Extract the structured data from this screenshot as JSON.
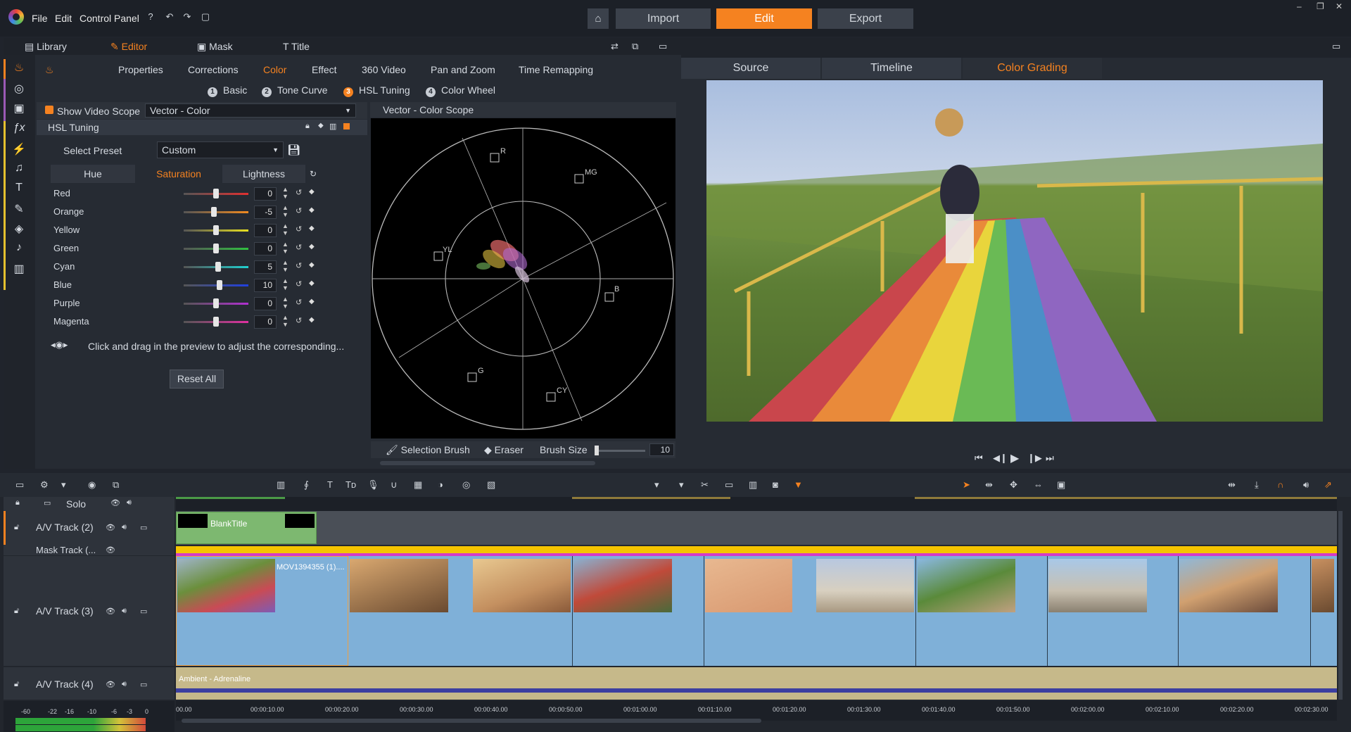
{
  "menu": {
    "file": "File",
    "edit": "Edit",
    "control_panel": "Control Panel"
  },
  "top_tabs": {
    "import": "Import",
    "edit": "Edit",
    "export": "Export"
  },
  "panel_tabs": [
    {
      "label": "Library"
    },
    {
      "label": "Editor"
    },
    {
      "label": "Mask"
    },
    {
      "label": "Title"
    }
  ],
  "subtabs": [
    "Properties",
    "Corrections",
    "Color",
    "Effect",
    "360 Video",
    "Pan and Zoom",
    "Time Remapping"
  ],
  "steps": [
    {
      "n": "1",
      "label": "Basic"
    },
    {
      "n": "2",
      "label": "Tone Curve"
    },
    {
      "n": "3",
      "label": "HSL Tuning"
    },
    {
      "n": "4",
      "label": "Color Wheel"
    }
  ],
  "scope": {
    "show_label": "Show Video Scope",
    "select_value": "Vector - Color",
    "panel_title": "Vector - Color Scope",
    "labels": [
      "R",
      "MG",
      "YL",
      "B",
      "G",
      "CY"
    ]
  },
  "hsl": {
    "title": "HSL Tuning",
    "preset_label": "Select Preset",
    "preset_value": "Custom",
    "headers": [
      "Hue",
      "Saturation",
      "Lightness"
    ],
    "rows": [
      {
        "name": "Red",
        "value": "0",
        "frac": 0.5
      },
      {
        "name": "Orange",
        "value": "-5",
        "frac": 0.47
      },
      {
        "name": "Yellow",
        "value": "0",
        "frac": 0.5
      },
      {
        "name": "Green",
        "value": "0",
        "frac": 0.5
      },
      {
        "name": "Cyan",
        "value": "5",
        "frac": 0.53
      },
      {
        "name": "Blue",
        "value": "10",
        "frac": 0.55
      },
      {
        "name": "Purple",
        "value": "0",
        "frac": 0.5
      },
      {
        "name": "Magenta",
        "value": "0",
        "frac": 0.5
      }
    ],
    "hint": "Click and drag in the preview to adjust the corresponding...",
    "reset": "Reset All"
  },
  "brush": {
    "selection": "Selection Brush",
    "eraser": "Eraser",
    "size_label": "Brush Size",
    "size_value": "10"
  },
  "preview_tabs": [
    "Source",
    "Timeline",
    "Color Grading"
  ],
  "tracks": {
    "solo": "Solo",
    "av2": "A/V Track (2)",
    "mask": "Mask Track (...",
    "av3": "A/V Track (3)",
    "av4": "A/V Track (4)"
  },
  "clips": {
    "title_clip": "BlankTitle",
    "video_clip": "MOV1394355 (1)....",
    "audio_clip": "Ambient - Adrenaline"
  },
  "ruler": [
    "00.00",
    "00:00:10.00",
    "00:00:20.00",
    "00:00:30.00",
    "00:00:40.00",
    "00:00:50.00",
    "00:01:00.00",
    "00:01:10.00",
    "00:01:20.00",
    "00:01:30.00",
    "00:01:40.00",
    "00:01:50.00",
    "00:02:00.00",
    "00:02:10.00",
    "00:02:20.00",
    "00:02:30.00"
  ],
  "meter_labels": [
    "-60",
    "-22",
    "-16",
    "-10",
    "-6",
    "-3",
    "0"
  ],
  "colors": {
    "accent": "#f58220",
    "track_bg": "#7fb0d8",
    "title_clip": "#7db870",
    "audio_clip": "#c6b98a"
  }
}
